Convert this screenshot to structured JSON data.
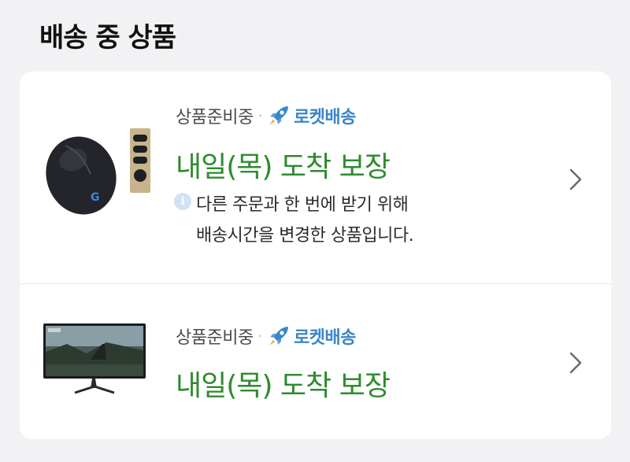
{
  "section": {
    "title": "배송 중 상품"
  },
  "items": [
    {
      "status": "상품준비중",
      "separator": "·",
      "delivery_type": "로켓배송",
      "arrival": "내일(목) 도착 보장",
      "notice_line1": "다른 주문과 한 번에 받기 위해",
      "notice_line2": "배송시간을 변경한 상품입니다.",
      "product_icon": "wireless-mouse"
    },
    {
      "status": "상품준비중",
      "separator": "·",
      "delivery_type": "로켓배송",
      "arrival": "내일(목) 도착 보장",
      "product_icon": "monitor"
    }
  ],
  "colors": {
    "arrival": "#2e8b2e",
    "rocket_text": "#3a86c8",
    "background": "#f2f2f4",
    "card": "#ffffff"
  }
}
